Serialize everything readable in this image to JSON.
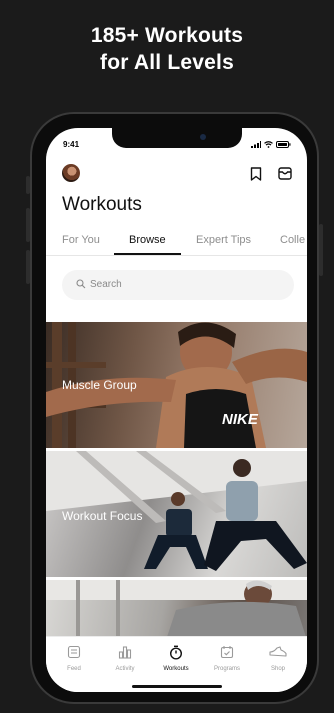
{
  "promo": {
    "line1": "185+ Workouts",
    "line2": "for All Levels"
  },
  "status_bar": {
    "time": "9:41"
  },
  "header": {
    "title": "Workouts"
  },
  "tabs": [
    {
      "label": "For You",
      "active": false
    },
    {
      "label": "Browse",
      "active": true
    },
    {
      "label": "Expert Tips",
      "active": false
    },
    {
      "label": "Colle",
      "active": false
    }
  ],
  "search": {
    "placeholder": "Search"
  },
  "cards": [
    {
      "label": "Muscle Group"
    },
    {
      "label": "Workout Focus"
    },
    {
      "label": ""
    }
  ],
  "tabbar": [
    {
      "label": "Feed",
      "icon": "feed-icon",
      "active": false
    },
    {
      "label": "Activity",
      "icon": "activity-icon",
      "active": false
    },
    {
      "label": "Workouts",
      "icon": "stopwatch-icon",
      "active": true
    },
    {
      "label": "Programs",
      "icon": "calendar-icon",
      "active": false
    },
    {
      "label": "Shop",
      "icon": "shoe-icon",
      "active": false
    }
  ],
  "colors": {
    "background": "#1b1b1b",
    "text_active": "#111111",
    "text_inactive": "#8e8e8e"
  }
}
